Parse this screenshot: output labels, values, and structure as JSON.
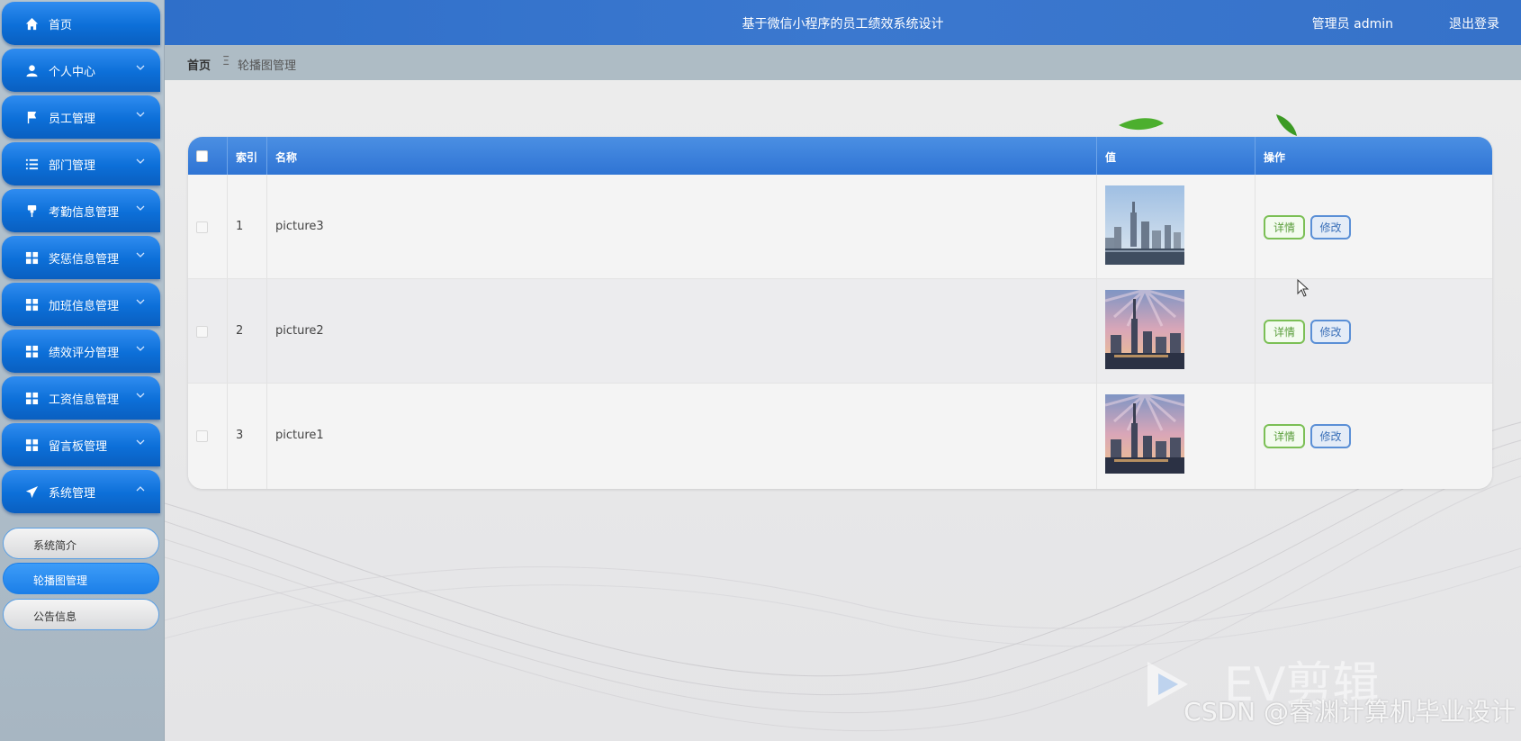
{
  "header": {
    "title": "基于微信小程序的员工绩效系统设计",
    "user": "管理员 admin",
    "logout": "退出登录"
  },
  "breadcrumb": {
    "home": "首页",
    "separator": "Ξ",
    "current": "轮播图管理"
  },
  "sidebar": {
    "items": [
      {
        "label": "首页",
        "icon": "home-icon"
      },
      {
        "label": "个人中心",
        "icon": "user-icon"
      },
      {
        "label": "员工管理",
        "icon": "flag-icon"
      },
      {
        "label": "部门管理",
        "icon": "list-icon"
      },
      {
        "label": "考勤信息管理",
        "icon": "pin-icon"
      },
      {
        "label": "奖惩信息管理",
        "icon": "grid-icon"
      },
      {
        "label": "加班信息管理",
        "icon": "grid-icon"
      },
      {
        "label": "绩效评分管理",
        "icon": "grid-icon"
      },
      {
        "label": "工资信息管理",
        "icon": "grid-icon"
      },
      {
        "label": "留言板管理",
        "icon": "grid-icon"
      },
      {
        "label": "系统管理",
        "icon": "send-icon"
      }
    ],
    "sub_items": [
      {
        "label": "系统简介",
        "active": false
      },
      {
        "label": "轮播图管理",
        "active": true
      },
      {
        "label": "公告信息",
        "active": false
      }
    ]
  },
  "table": {
    "columns": [
      "索引",
      "名称",
      "值",
      "操作"
    ],
    "rows": [
      {
        "index": "1",
        "name": "picture3"
      },
      {
        "index": "2",
        "name": "picture2"
      },
      {
        "index": "3",
        "name": "picture1"
      }
    ],
    "actions": {
      "detail": "详情",
      "edit": "修改"
    }
  },
  "watermark": {
    "brand": "EV剪辑",
    "credit": "CSDN @睿渊计算机毕业设计"
  },
  "colors": {
    "header": "#3672c9",
    "menu": "#0c6fd8",
    "detail": "#7bbf55",
    "edit": "#5a8fd6"
  }
}
